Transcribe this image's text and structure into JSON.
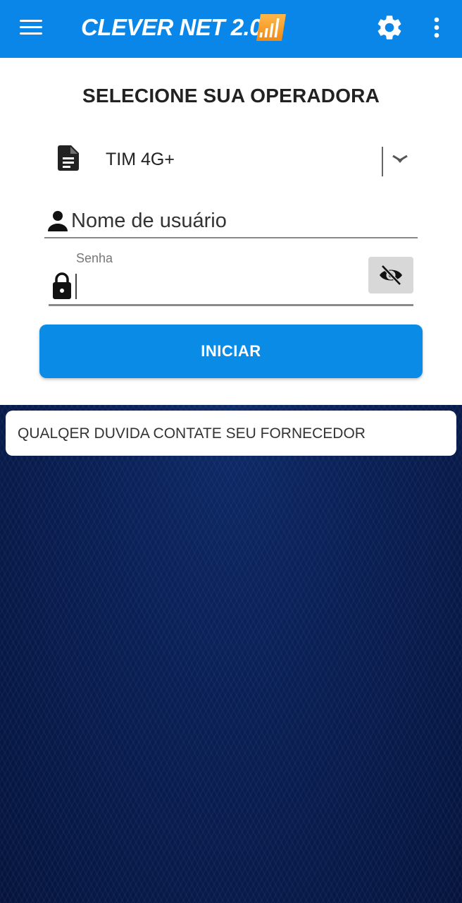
{
  "app_bar": {
    "title": "CLEVER NET 2.0",
    "background": "#0a85e8",
    "icons": [
      "menu-icon",
      "signal-bars-icon",
      "gear-icon",
      "more-vert-icon"
    ]
  },
  "login_card": {
    "title": "SELECIONE SUA OPERADORA",
    "operator": {
      "selected": "TIM 4G+",
      "icon": "document-icon"
    },
    "username": {
      "placeholder": "Nome de usuário",
      "icon": "person-icon"
    },
    "password": {
      "label": "Senha",
      "value": "",
      "icon": "lock-icon",
      "toggle_icon": "eye-off-icon"
    },
    "start_button": {
      "label": "INICIAR",
      "color": "#0a8be6"
    }
  },
  "info_card": {
    "text": "QUALQER DUVIDA CONTATE SEU FORNECEDOR"
  }
}
